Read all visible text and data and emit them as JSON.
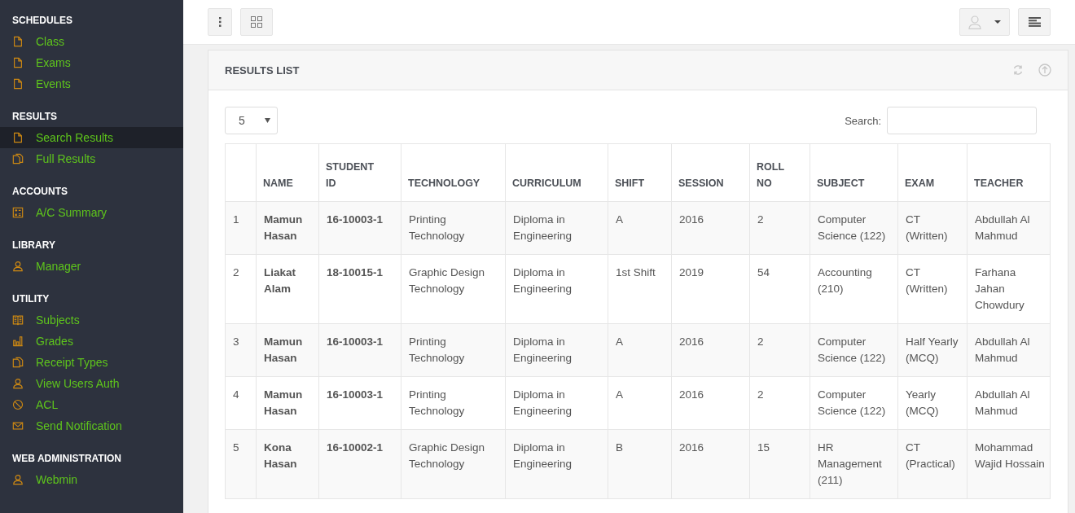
{
  "sidebar": {
    "sections": [
      {
        "title": "SCHEDULES",
        "items": [
          {
            "label": "Class",
            "selected": false
          },
          {
            "label": "Exams",
            "selected": false
          },
          {
            "label": "Events",
            "selected": false
          }
        ]
      },
      {
        "title": "RESULTS",
        "items": [
          {
            "label": "Search Results",
            "selected": true
          },
          {
            "label": "Full Results",
            "selected": false
          }
        ]
      },
      {
        "title": "ACCOUNTS",
        "items": [
          {
            "label": "A/C Summary",
            "selected": false
          }
        ]
      },
      {
        "title": "LIBRARY",
        "items": [
          {
            "label": "Manager",
            "selected": false
          }
        ]
      },
      {
        "title": "UTILITY",
        "items": [
          {
            "label": "Subjects",
            "selected": false
          },
          {
            "label": "Grades",
            "selected": false
          },
          {
            "label": "Receipt Types",
            "selected": false
          },
          {
            "label": "View Users Auth",
            "selected": false
          },
          {
            "label": "ACL",
            "selected": false
          },
          {
            "label": "Send Notification",
            "selected": false
          }
        ]
      },
      {
        "title": "WEB ADMINISTRATION",
        "items": [
          {
            "label": "Webmin",
            "selected": false
          }
        ]
      }
    ]
  },
  "panel": {
    "title": "RESULTS LIST",
    "page_size": "5",
    "search_label": "Search:",
    "table": {
      "columns": [
        "",
        "NAME",
        "STUDENT ID",
        "TECHNOLOGY",
        "CURRICULUM",
        "SHIFT",
        "SESSION",
        "ROLL NO",
        "SUBJECT",
        "EXAM",
        "TEACHER"
      ],
      "rows": [
        [
          "1",
          "Mamun Hasan",
          "16-10003-1",
          "Printing Technology",
          "Diploma in Engineering",
          "A",
          "2016",
          "2",
          "Computer Science (122)",
          "CT (Written)",
          "Abdullah Al Mahmud"
        ],
        [
          "2",
          "Liakat Alam",
          "18-10015-1",
          "Graphic Design Technology",
          "Diploma in Engineering",
          "1st Shift",
          "2019",
          "54",
          "Accounting (210)",
          "CT (Written)",
          "Farhana Jahan Chowdury"
        ],
        [
          "3",
          "Mamun Hasan",
          "16-10003-1",
          "Printing Technology",
          "Diploma in Engineering",
          "A",
          "2016",
          "2",
          "Computer Science (122)",
          "Half Yearly (MCQ)",
          "Abdullah Al Mahmud"
        ],
        [
          "4",
          "Mamun Hasan",
          "16-10003-1",
          "Printing Technology",
          "Diploma in Engineering",
          "A",
          "2016",
          "2",
          "Computer Science (122)",
          "Yearly (MCQ)",
          "Abdullah Al Mahmud"
        ],
        [
          "5",
          "Kona Hasan",
          "16-10002-1",
          "Graphic Design Technology",
          "Diploma in Engineering",
          "B",
          "2016",
          "15",
          "HR Management (211)",
          "CT (Practical)",
          "Mohammad Wajid Hossain"
        ]
      ]
    }
  }
}
